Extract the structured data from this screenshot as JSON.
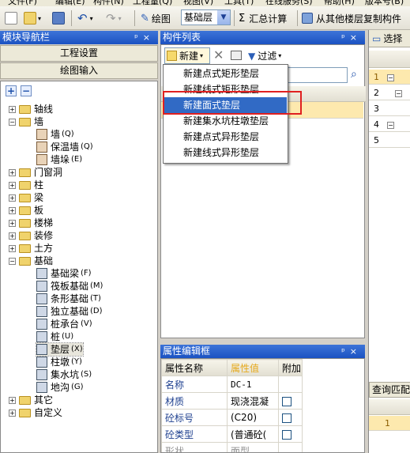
{
  "menu": {
    "items": [
      "文件(F)",
      "编辑(E)",
      "构件(N)",
      "工程量(Q)",
      "视图(V)",
      "工具(T)",
      "在线服务(S)",
      "帮助(H)",
      "版本号(B)"
    ]
  },
  "toolbar": {
    "draw_label": "绘图",
    "layer_value": "基础层",
    "sum_label": "汇总计算",
    "copy_label": "从其他楼层复制构件"
  },
  "nav": {
    "title": "模块导航栏",
    "btn_project": "工程设置",
    "btn_draw": "绘图输入",
    "tree": [
      {
        "label": "轴线",
        "type": "folder",
        "state": "+"
      },
      {
        "label": "墙",
        "type": "folder",
        "state": "-"
      },
      {
        "label": "墙",
        "key": "(Q)",
        "type": "leaf"
      },
      {
        "label": "保温墙",
        "key": "(Q)",
        "type": "leaf"
      },
      {
        "label": "墙垛",
        "key": "(E)",
        "type": "leaf"
      },
      {
        "label": "门窗洞",
        "type": "folder",
        "state": "+"
      },
      {
        "label": "柱",
        "type": "folder",
        "state": "+"
      },
      {
        "label": "梁",
        "type": "folder",
        "state": "+"
      },
      {
        "label": "板",
        "type": "folder",
        "state": "+"
      },
      {
        "label": "楼梯",
        "type": "folder",
        "state": "+"
      },
      {
        "label": "装修",
        "type": "folder",
        "state": "+"
      },
      {
        "label": "土方",
        "type": "folder",
        "state": "+"
      },
      {
        "label": "基础",
        "type": "folder",
        "state": "-"
      },
      {
        "label": "基础梁",
        "key": "(F)",
        "type": "leaf2"
      },
      {
        "label": "筏板基础",
        "key": "(M)",
        "type": "leaf2"
      },
      {
        "label": "条形基础",
        "key": "(T)",
        "type": "leaf2"
      },
      {
        "label": "独立基础",
        "key": "(D)",
        "type": "leaf2"
      },
      {
        "label": "桩承台",
        "key": "(V)",
        "type": "leaf2"
      },
      {
        "label": "桩",
        "key": "(U)",
        "type": "leaf2"
      },
      {
        "label": "垫层",
        "key": "(X)",
        "type": "leaf2"
      },
      {
        "label": "柱墩",
        "key": "(Y)",
        "type": "leaf2"
      },
      {
        "label": "集水坑",
        "key": "(S)",
        "type": "leaf2"
      },
      {
        "label": "地沟",
        "key": "(G)",
        "type": "leaf2"
      },
      {
        "label": "其它",
        "type": "folder",
        "state": "+"
      },
      {
        "label": "自定义",
        "type": "folder",
        "state": "+"
      }
    ]
  },
  "components": {
    "title": "构件列表",
    "new_label": "新建",
    "filter_label": "过滤"
  },
  "new_menu": {
    "items": [
      "新建点式矩形垫层",
      "新建线式矩形垫层",
      "新建面式垫层",
      "新建集水坑柱墩垫层",
      "新建点式异形垫层",
      "新建线式异形垫层"
    ],
    "highlighted": 2
  },
  "props": {
    "title": "属性编辑框",
    "headers": [
      "属性名称",
      "属性值",
      "附加"
    ],
    "rows": [
      {
        "name": "名称",
        "value": "DC-1",
        "checkbox": false
      },
      {
        "name": "材质",
        "value": "现浇混凝",
        "checkbox": true
      },
      {
        "name": "砼标号",
        "value": "(C20)",
        "checkbox": true
      },
      {
        "name": "砼类型",
        "value": "(普通砼(",
        "checkbox": true
      },
      {
        "name": "形状",
        "value": "面型",
        "checkbox": false
      }
    ]
  },
  "right": {
    "select_label": "选择",
    "query_label": "查询匹配",
    "rows": [
      "1",
      "2",
      "3",
      "4",
      "5"
    ],
    "bottom_row": "1"
  },
  "colors": {
    "accent": "#316ac5",
    "title_blue": "#1b52c2",
    "highlight_row": "#fde9ae",
    "callout": "#e02020"
  }
}
